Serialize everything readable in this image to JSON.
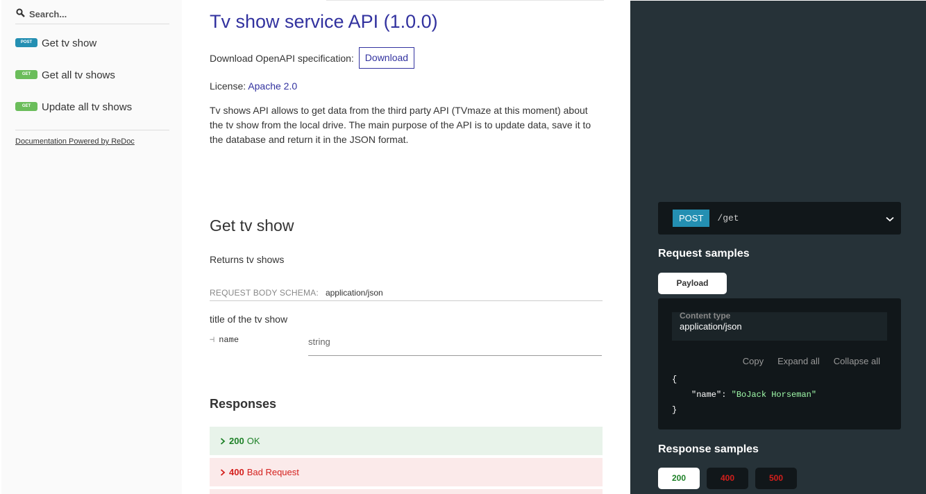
{
  "sidebar": {
    "search_placeholder": "Search...",
    "items": [
      {
        "method": "POST",
        "label": "Get tv show",
        "color": "#248fb2"
      },
      {
        "method": "GET",
        "label": "Get all tv shows",
        "color": "#6bbd5b"
      },
      {
        "method": "GET",
        "label": "Update all tv shows",
        "color": "#6bbd5b"
      }
    ],
    "powered_by": "Documentation Powered by ReDoc"
  },
  "main": {
    "title": "Tv show service API (1.0.0)",
    "download_label": "Download OpenAPI specification:",
    "download_button": "Download",
    "license_label": "License:",
    "license_link": "Apache 2.0",
    "description": "Tv shows API allows to get data from the third party API (TVmaze at this moment) about the tv show from the local drive. The main purpose of the API is to update data, save it to the database and return it in the JSON format.",
    "operation": {
      "title": "Get tv show",
      "description": "Returns tv shows",
      "schema_label": "REQUEST BODY SCHEMA:",
      "schema_type": "application/json",
      "property_description": "title of the tv show",
      "property_name": "name",
      "property_type": "string",
      "responses_title": "Responses",
      "responses": [
        {
          "code": "200",
          "text": "OK"
        },
        {
          "code": "400",
          "text": "Bad Request"
        }
      ]
    }
  },
  "right_panel": {
    "method": "POST",
    "path": "/get",
    "request_samples_title": "Request samples",
    "payload_tab": "Payload",
    "content_type_label": "Content type",
    "content_type_value": "application/json",
    "actions": {
      "copy": "Copy",
      "expand": "Expand all",
      "collapse": "Collapse all"
    },
    "sample": {
      "open": "{",
      "key": "\"name\"",
      "colon": ": ",
      "value": "\"BoJack Horseman\"",
      "close": "}"
    },
    "response_samples_title": "Response samples",
    "response_tabs": [
      "200",
      "400",
      "500"
    ]
  },
  "colors": {
    "accent": "#32329f",
    "post": "#248fb2",
    "get": "#6bbd5b",
    "success": "#1d8127",
    "error": "#d41f1c",
    "panel_bg": "#263238"
  }
}
